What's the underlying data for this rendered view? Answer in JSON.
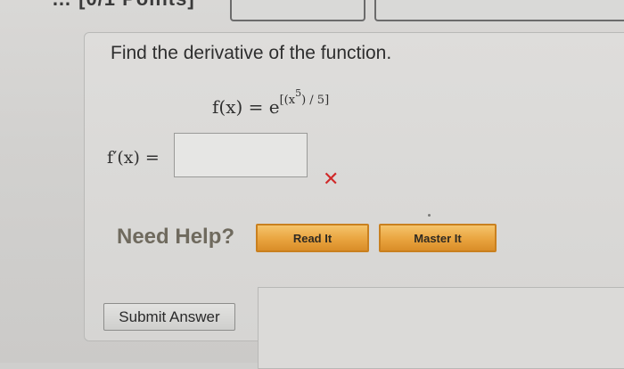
{
  "top": {
    "heading_fragment": "… [0/1 Points]"
  },
  "question": {
    "prompt": "Find the derivative of the function.",
    "function_lhs": "f(x) = e",
    "exponent_open": "[(x",
    "exponent_power": "5",
    "exponent_close": ") / 5]",
    "derivative_label": "f′(x) =",
    "answer_value": "",
    "status": "✕"
  },
  "help": {
    "label": "Need Help?",
    "buttons": [
      "Read It",
      "Master It"
    ]
  },
  "actions": {
    "submit_label": "Submit Answer"
  },
  "colors": {
    "accent_orange": "#e9a43f",
    "error_red": "#d02a2a"
  }
}
